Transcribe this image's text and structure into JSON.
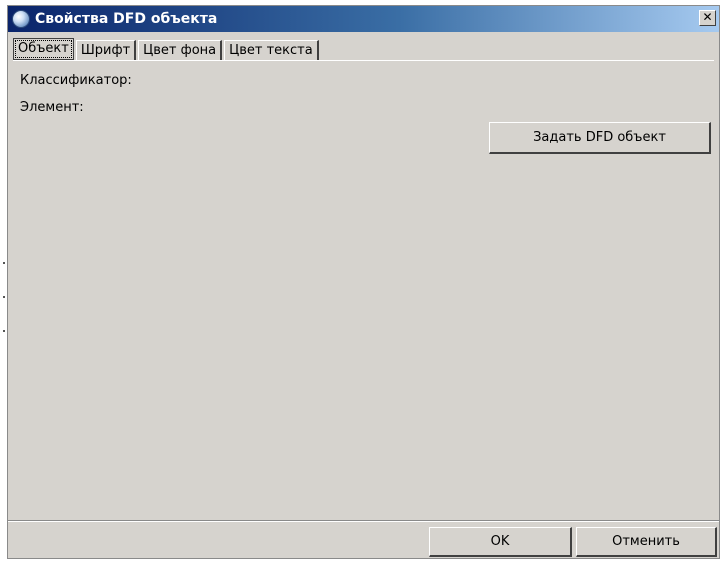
{
  "window": {
    "title": "Свойства DFD объекта",
    "close_glyph": "✕",
    "icon": "app-globe-icon"
  },
  "tabs": [
    {
      "label": "Объект",
      "active": true
    },
    {
      "label": "Шрифт",
      "active": false
    },
    {
      "label": "Цвет фона",
      "active": false
    },
    {
      "label": "Цвет текста",
      "active": false
    }
  ],
  "object_tab": {
    "classifier_label": "Классификатор:",
    "element_label": "Элемент:",
    "set_dfd_button": "Задать DFD объект"
  },
  "footer": {
    "ok_label": "OK",
    "cancel_label": "Отменить"
  },
  "colors": {
    "dialog_background": "#d6d3ce",
    "titlebar_start": "#0a246a",
    "titlebar_end": "#a6caf0"
  }
}
